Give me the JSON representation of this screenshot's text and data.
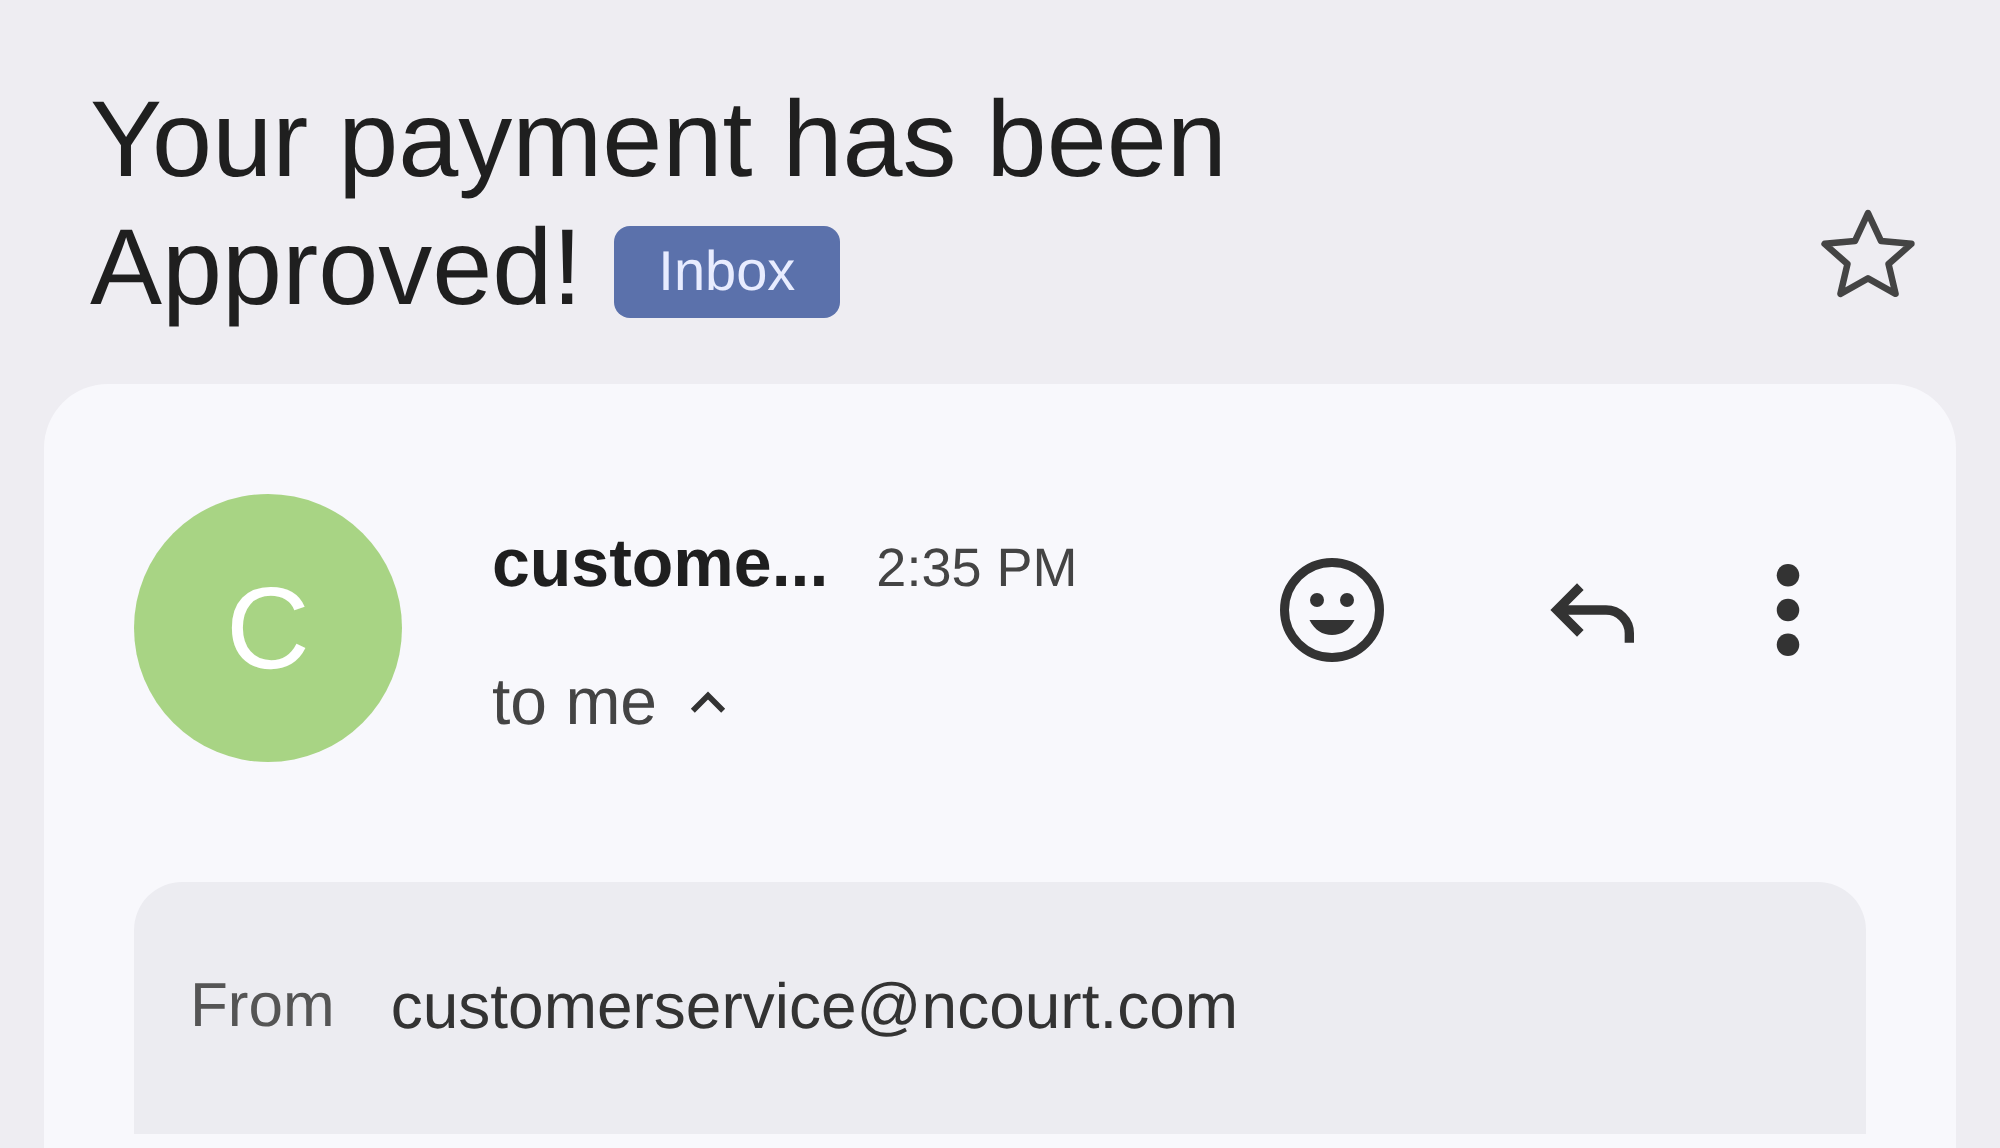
{
  "subject": {
    "lines": [
      "Your payment has been",
      "Approved!"
    ],
    "label": "Inbox",
    "starred": false
  },
  "message": {
    "avatar": {
      "letter": "C",
      "color": "#a8d484"
    },
    "sender": "custome...",
    "time": "2:35 PM",
    "recipient": "to me",
    "details_expanded": true,
    "details": [
      {
        "label": "From",
        "value": "customerservice@ncourt.com"
      }
    ]
  }
}
